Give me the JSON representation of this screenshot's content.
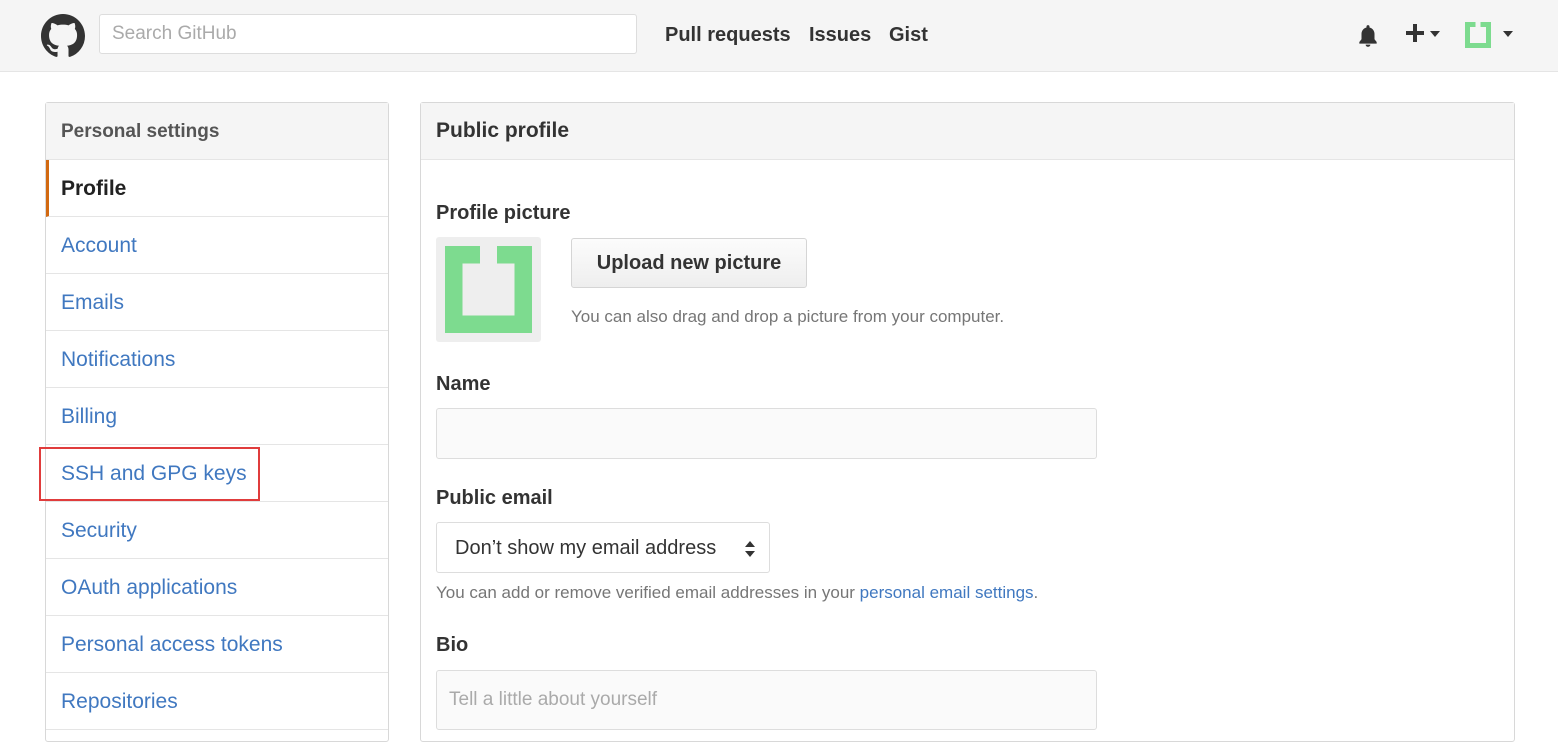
{
  "header": {
    "search_placeholder": "Search GitHub",
    "nav": [
      "Pull requests",
      "Issues",
      "Gist"
    ],
    "icons": [
      "github-logo-icon",
      "bell-icon",
      "plus-icon",
      "avatar-icon"
    ]
  },
  "sidebar": {
    "title": "Personal settings",
    "items": [
      {
        "label": "Profile",
        "selected": true
      },
      {
        "label": "Account"
      },
      {
        "label": "Emails"
      },
      {
        "label": "Notifications"
      },
      {
        "label": "Billing"
      },
      {
        "label": "SSH and GPG keys",
        "highlighted": true
      },
      {
        "label": "Security"
      },
      {
        "label": "OAuth applications"
      },
      {
        "label": "Personal access tokens"
      },
      {
        "label": "Repositories"
      }
    ]
  },
  "main": {
    "title": "Public profile",
    "profile_picture_label": "Profile picture",
    "upload_button": "Upload new picture",
    "upload_note": "You can also drag and drop a picture from your computer.",
    "name_label": "Name",
    "name_value": "",
    "public_email_label": "Public email",
    "public_email_selected": "Don’t show my email address",
    "email_note_prefix": "You can add or remove verified email addresses in your ",
    "email_note_link": "personal email settings",
    "email_note_suffix": ".",
    "bio_label": "Bio",
    "bio_placeholder": "Tell a little about yourself"
  },
  "colors": {
    "link": "#4078c0",
    "selected_accent": "#d26911",
    "highlight_box": "#e03c3c",
    "identicon": "#7ddb8f"
  }
}
